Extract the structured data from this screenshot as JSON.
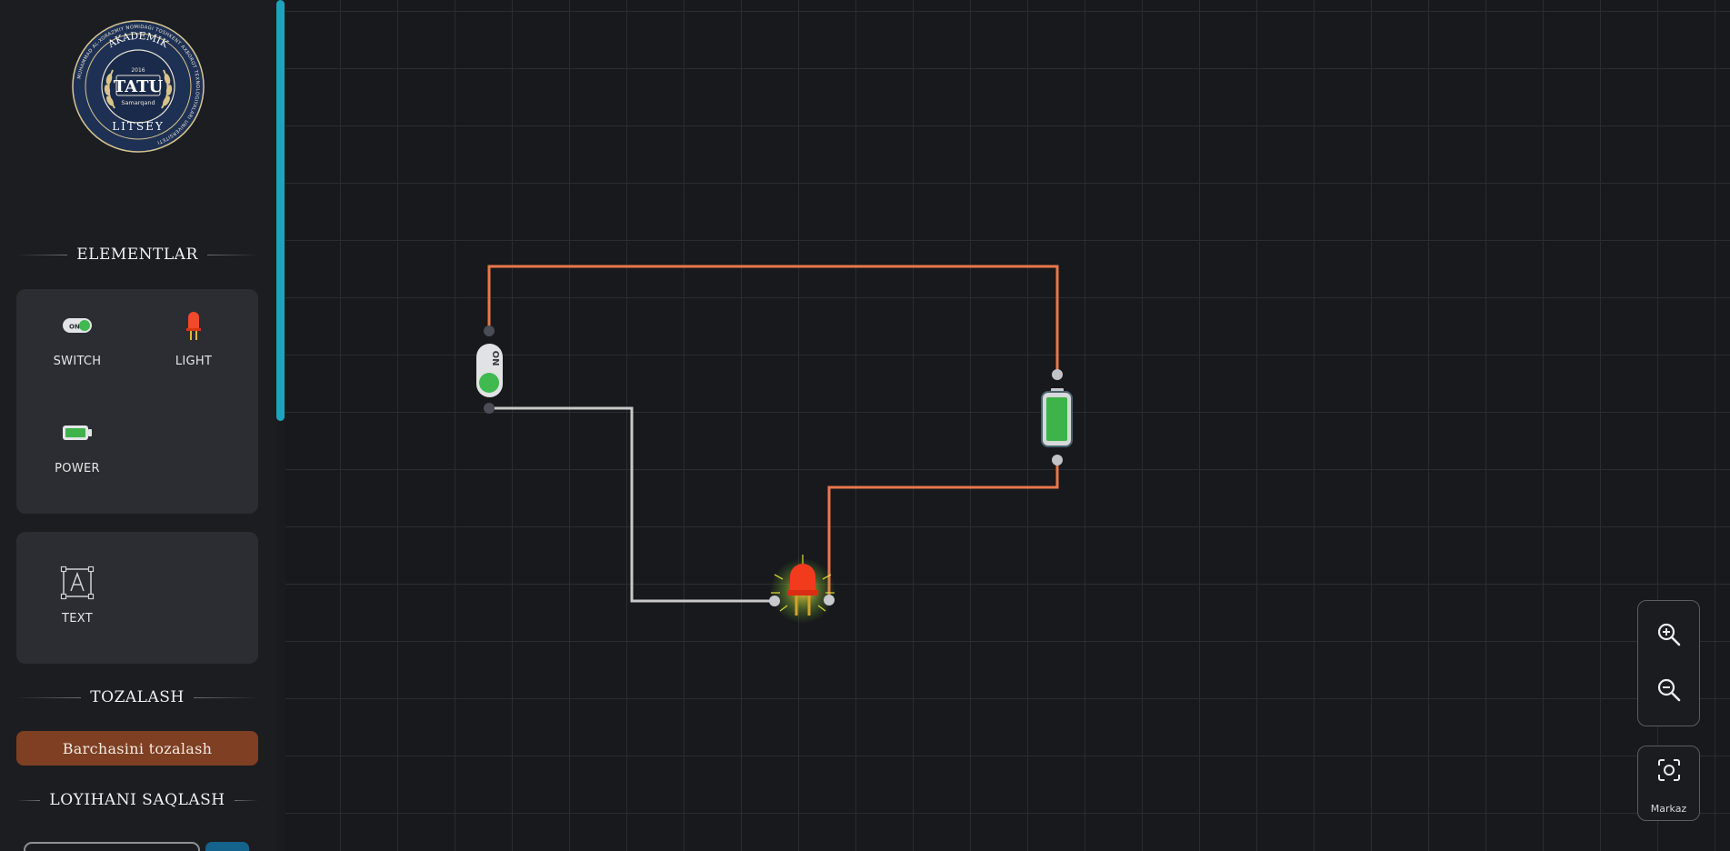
{
  "sidebar": {
    "logo": {
      "top_arc": "AKADEMIK",
      "year": "2016",
      "name": "TATU",
      "city": "Samarqand",
      "bottom_arc": "LITSEY",
      "ring_text": "MUHAMMAD AL-XORAZMIY NOMIDAGI TOSHKENT AXBOROT TEXNOLOGIYALARI UNIVERSITETI"
    },
    "elements_title": "ELEMENTLAR",
    "elements": [
      {
        "label": "SWITCH",
        "icon": "switch-icon"
      },
      {
        "label": "LIGHT",
        "icon": "led-icon"
      },
      {
        "label": "POWER",
        "icon": "battery-icon"
      }
    ],
    "text_tool": {
      "label": "TEXT",
      "icon": "text-box-icon"
    },
    "clear_title": "TOZALASH",
    "clear_button": "Barchasini tozalash",
    "save_title": "LOYIHANI SAQLASH"
  },
  "canvas": {
    "switch_text": "ON",
    "switch_state": "on",
    "light_state": "lit",
    "battery_charge": 1.0,
    "colors": {
      "wire_power": "#e8784a",
      "wire_return": "#c8c8c8",
      "accent": "#1da3bd",
      "battery_green": "#3db34a",
      "led_red": "#f23a1d"
    }
  },
  "controls": {
    "zoom_in_icon": "zoom-in-icon",
    "zoom_out_icon": "zoom-out-icon",
    "center_icon": "focus-center-icon",
    "center_label": "Markaz"
  }
}
